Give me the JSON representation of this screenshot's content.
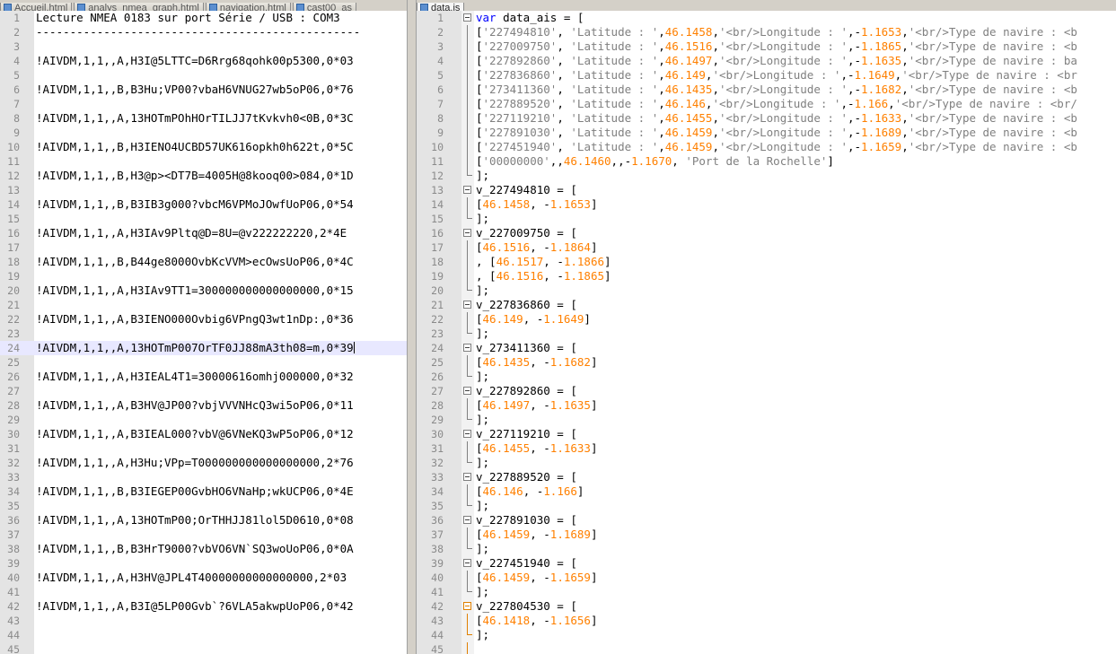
{
  "left_tabs": [
    "Accueil.html",
    "analys_nmea_graph.html",
    "navigation.html",
    "cast00_as"
  ],
  "right_tabs": [
    "data.js"
  ],
  "left_lines": [
    "Lecture NMEA 0183 sur port Série / USB : COM3",
    "------------------------------------------------",
    "",
    "!AIVDM,1,1,,A,H3I@5LTTC=D6Rrg68qohk00p5300,0*03",
    "",
    "!AIVDM,1,1,,B,B3Hu;VP00?vbaH6VNUG27wb5oP06,0*76",
    "",
    "!AIVDM,1,1,,A,13HOTmPOhHOrTILJJ7tKvkvh0<0B,0*3C",
    "",
    "!AIVDM,1,1,,B,H3IENO4UCBD57UK616opkh0h622t,0*5C",
    "",
    "!AIVDM,1,1,,B,H3@p><DT7B=4005H@8kooq00>084,0*1D",
    "",
    "!AIVDM,1,1,,B,B3IB3g000?vbcM6VPMoJOwfUoP06,0*54",
    "",
    "!AIVDM,1,1,,A,H3IAv9Pltq@D=8U=@v222222220,2*4E",
    "",
    "!AIVDM,1,1,,B,B44ge8000OvbKcVVM>ecOwsUoP06,0*4C",
    "",
    "!AIVDM,1,1,,A,H3IAv9TT1=300000000000000000,0*15",
    "",
    "!AIVDM,1,1,,A,B3IENO000Ovbig6VPngQ3wt1nDp:,0*36",
    "",
    "!AIVDM,1,1,,A,13HOTmP007OrTF0JJ88mA3th08=m,0*39",
    "",
    "!AIVDM,1,1,,A,H3IEAL4T1=30000616omhj000000,0*32",
    "",
    "!AIVDM,1,1,,A,B3HV@JP00?vbjVVVNHcQ3wi5oP06,0*11",
    "",
    "!AIVDM,1,1,,A,B3IEAL000?vbV@6VNeKQ3wP5oP06,0*12",
    "",
    "!AIVDM,1,1,,A,H3Hu;VPp=T000000000000000000,2*76",
    "",
    "!AIVDM,1,1,,B,B3IEGEP00GvbHO6VNaHp;wkUCP06,0*4E",
    "",
    "!AIVDM,1,1,,A,13HOTmP00;OrTHHJJ81lol5D0610,0*08",
    "",
    "!AIVDM,1,1,,B,B3HrT9000?vbVO6VN`SQ3woUoP06,0*0A",
    "",
    "!AIVDM,1,1,,A,H3HV@JPL4T40000000000000000,2*03",
    "",
    "!AIVDM,1,1,,A,B3I@5LP00Gvb`?6VLA5akwpUoP06,0*42",
    "",
    "",
    "",
    ""
  ],
  "right_lines": [
    [
      [
        "kw",
        "var "
      ],
      [
        "plain",
        "data_ais = ["
      ]
    ],
    [
      [
        "plain",
        "["
      ],
      [
        "str",
        "'227494810'"
      ],
      [
        "plain",
        ", "
      ],
      [
        "str",
        "'Latitude : '"
      ],
      [
        "plain",
        ","
      ],
      [
        "num",
        "46.1458"
      ],
      [
        "plain",
        ","
      ],
      [
        "str",
        "'<br/>Longitude : '"
      ],
      [
        "plain",
        ",-"
      ],
      [
        "num",
        "1.1653"
      ],
      [
        "plain",
        ","
      ],
      [
        "str",
        "'<br/>Type de navire : <b"
      ]
    ],
    [
      [
        "plain",
        "["
      ],
      [
        "str",
        "'227009750'"
      ],
      [
        "plain",
        ", "
      ],
      [
        "str",
        "'Latitude : '"
      ],
      [
        "plain",
        ","
      ],
      [
        "num",
        "46.1516"
      ],
      [
        "plain",
        ","
      ],
      [
        "str",
        "'<br/>Longitude : '"
      ],
      [
        "plain",
        ",-"
      ],
      [
        "num",
        "1.1865"
      ],
      [
        "plain",
        ","
      ],
      [
        "str",
        "'<br/>Type de navire : <b"
      ]
    ],
    [
      [
        "plain",
        "["
      ],
      [
        "str",
        "'227892860'"
      ],
      [
        "plain",
        ", "
      ],
      [
        "str",
        "'Latitude : '"
      ],
      [
        "plain",
        ","
      ],
      [
        "num",
        "46.1497"
      ],
      [
        "plain",
        ","
      ],
      [
        "str",
        "'<br/>Longitude : '"
      ],
      [
        "plain",
        ",-"
      ],
      [
        "num",
        "1.1635"
      ],
      [
        "plain",
        ","
      ],
      [
        "str",
        "'<br/>Type de navire : ba"
      ]
    ],
    [
      [
        "plain",
        "["
      ],
      [
        "str",
        "'227836860'"
      ],
      [
        "plain",
        ", "
      ],
      [
        "str",
        "'Latitude : '"
      ],
      [
        "plain",
        ","
      ],
      [
        "num",
        "46.149"
      ],
      [
        "plain",
        ","
      ],
      [
        "str",
        "'<br/>Longitude : '"
      ],
      [
        "plain",
        ",-"
      ],
      [
        "num",
        "1.1649"
      ],
      [
        "plain",
        ","
      ],
      [
        "str",
        "'<br/>Type de navire : <br"
      ]
    ],
    [
      [
        "plain",
        "["
      ],
      [
        "str",
        "'273411360'"
      ],
      [
        "plain",
        ", "
      ],
      [
        "str",
        "'Latitude : '"
      ],
      [
        "plain",
        ","
      ],
      [
        "num",
        "46.1435"
      ],
      [
        "plain",
        ","
      ],
      [
        "str",
        "'<br/>Longitude : '"
      ],
      [
        "plain",
        ",-"
      ],
      [
        "num",
        "1.1682"
      ],
      [
        "plain",
        ","
      ],
      [
        "str",
        "'<br/>Type de navire : <b"
      ]
    ],
    [
      [
        "plain",
        "["
      ],
      [
        "str",
        "'227889520'"
      ],
      [
        "plain",
        ", "
      ],
      [
        "str",
        "'Latitude : '"
      ],
      [
        "plain",
        ","
      ],
      [
        "num",
        "46.146"
      ],
      [
        "plain",
        ","
      ],
      [
        "str",
        "'<br/>Longitude : '"
      ],
      [
        "plain",
        ",-"
      ],
      [
        "num",
        "1.166"
      ],
      [
        "plain",
        ","
      ],
      [
        "str",
        "'<br/>Type de navire : <br/"
      ]
    ],
    [
      [
        "plain",
        "["
      ],
      [
        "str",
        "'227119210'"
      ],
      [
        "plain",
        ", "
      ],
      [
        "str",
        "'Latitude : '"
      ],
      [
        "plain",
        ","
      ],
      [
        "num",
        "46.1455"
      ],
      [
        "plain",
        ","
      ],
      [
        "str",
        "'<br/>Longitude : '"
      ],
      [
        "plain",
        ",-"
      ],
      [
        "num",
        "1.1633"
      ],
      [
        "plain",
        ","
      ],
      [
        "str",
        "'<br/>Type de navire : <b"
      ]
    ],
    [
      [
        "plain",
        "["
      ],
      [
        "str",
        "'227891030'"
      ],
      [
        "plain",
        ", "
      ],
      [
        "str",
        "'Latitude : '"
      ],
      [
        "plain",
        ","
      ],
      [
        "num",
        "46.1459"
      ],
      [
        "plain",
        ","
      ],
      [
        "str",
        "'<br/>Longitude : '"
      ],
      [
        "plain",
        ",-"
      ],
      [
        "num",
        "1.1689"
      ],
      [
        "plain",
        ","
      ],
      [
        "str",
        "'<br/>Type de navire : <b"
      ]
    ],
    [
      [
        "plain",
        "["
      ],
      [
        "str",
        "'227451940'"
      ],
      [
        "plain",
        ", "
      ],
      [
        "str",
        "'Latitude : '"
      ],
      [
        "plain",
        ","
      ],
      [
        "num",
        "46.1459"
      ],
      [
        "plain",
        ","
      ],
      [
        "str",
        "'<br/>Longitude : '"
      ],
      [
        "plain",
        ",-"
      ],
      [
        "num",
        "1.1659"
      ],
      [
        "plain",
        ","
      ],
      [
        "str",
        "'<br/>Type de navire : <b"
      ]
    ],
    [
      [
        "plain",
        "["
      ],
      [
        "str",
        "'00000000'"
      ],
      [
        "plain",
        ",,"
      ],
      [
        "num",
        "46.1460"
      ],
      [
        "plain",
        ",,-"
      ],
      [
        "num",
        "1.1670"
      ],
      [
        "plain",
        ", "
      ],
      [
        "str",
        "'Port de la Rochelle'"
      ],
      [
        "plain",
        "]"
      ]
    ],
    [
      [
        "plain",
        "];"
      ]
    ],
    [
      [
        "plain",
        "v_227494810 = ["
      ]
    ],
    [
      [
        "plain",
        "["
      ],
      [
        "num",
        "46.1458"
      ],
      [
        "plain",
        ", -"
      ],
      [
        "num",
        "1.1653"
      ],
      [
        "plain",
        "]"
      ]
    ],
    [
      [
        "plain",
        "];"
      ]
    ],
    [
      [
        "plain",
        "v_227009750 = ["
      ]
    ],
    [
      [
        "plain",
        "["
      ],
      [
        "num",
        "46.1516"
      ],
      [
        "plain",
        ", -"
      ],
      [
        "num",
        "1.1864"
      ],
      [
        "plain",
        "]"
      ]
    ],
    [
      [
        "plain",
        ", ["
      ],
      [
        "num",
        "46.1517"
      ],
      [
        "plain",
        ", -"
      ],
      [
        "num",
        "1.1866"
      ],
      [
        "plain",
        "]"
      ]
    ],
    [
      [
        "plain",
        ", ["
      ],
      [
        "num",
        "46.1516"
      ],
      [
        "plain",
        ", -"
      ],
      [
        "num",
        "1.1865"
      ],
      [
        "plain",
        "]"
      ]
    ],
    [
      [
        "plain",
        "];"
      ]
    ],
    [
      [
        "plain",
        "v_227836860 = ["
      ]
    ],
    [
      [
        "plain",
        "["
      ],
      [
        "num",
        "46.149"
      ],
      [
        "plain",
        ", -"
      ],
      [
        "num",
        "1.1649"
      ],
      [
        "plain",
        "]"
      ]
    ],
    [
      [
        "plain",
        "];"
      ]
    ],
    [
      [
        "plain",
        "v_273411360 = ["
      ]
    ],
    [
      [
        "plain",
        "["
      ],
      [
        "num",
        "46.1435"
      ],
      [
        "plain",
        ", -"
      ],
      [
        "num",
        "1.1682"
      ],
      [
        "plain",
        "]"
      ]
    ],
    [
      [
        "plain",
        "];"
      ]
    ],
    [
      [
        "plain",
        "v_227892860 = ["
      ]
    ],
    [
      [
        "plain",
        "["
      ],
      [
        "num",
        "46.1497"
      ],
      [
        "plain",
        ", -"
      ],
      [
        "num",
        "1.1635"
      ],
      [
        "plain",
        "]"
      ]
    ],
    [
      [
        "plain",
        "];"
      ]
    ],
    [
      [
        "plain",
        "v_227119210 = ["
      ]
    ],
    [
      [
        "plain",
        "["
      ],
      [
        "num",
        "46.1455"
      ],
      [
        "plain",
        ", -"
      ],
      [
        "num",
        "1.1633"
      ],
      [
        "plain",
        "]"
      ]
    ],
    [
      [
        "plain",
        "];"
      ]
    ],
    [
      [
        "plain",
        "v_227889520 = ["
      ]
    ],
    [
      [
        "plain",
        "["
      ],
      [
        "num",
        "46.146"
      ],
      [
        "plain",
        ", -"
      ],
      [
        "num",
        "1.166"
      ],
      [
        "plain",
        "]"
      ]
    ],
    [
      [
        "plain",
        "];"
      ]
    ],
    [
      [
        "plain",
        "v_227891030 = ["
      ]
    ],
    [
      [
        "plain",
        "["
      ],
      [
        "num",
        "46.1459"
      ],
      [
        "plain",
        ", -"
      ],
      [
        "num",
        "1.1689"
      ],
      [
        "plain",
        "]"
      ]
    ],
    [
      [
        "plain",
        "];"
      ]
    ],
    [
      [
        "plain",
        "v_227451940 = ["
      ]
    ],
    [
      [
        "plain",
        "["
      ],
      [
        "num",
        "46.1459"
      ],
      [
        "plain",
        ", -"
      ],
      [
        "num",
        "1.1659"
      ],
      [
        "plain",
        "]"
      ]
    ],
    [
      [
        "plain",
        "];"
      ]
    ],
    [
      [
        "plain",
        "v_227804530 = ["
      ]
    ],
    [
      [
        "plain",
        "["
      ],
      [
        "num",
        "46.1418"
      ],
      [
        "plain",
        ", -"
      ],
      [
        "num",
        "1.1656"
      ],
      [
        "plain",
        "]"
      ]
    ],
    [
      [
        "plain",
        "];"
      ]
    ],
    []
  ],
  "colors": {
    "keyword": "#0000ff",
    "string": "#808080",
    "number": "#ff8000",
    "fold_orange": "#e08000",
    "gutter": "#e4e4e4",
    "current_line": "#e8e8ff"
  }
}
